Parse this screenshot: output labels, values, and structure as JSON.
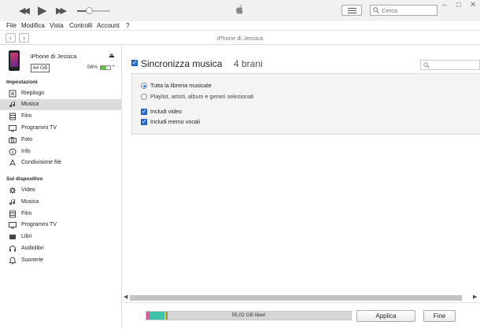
{
  "player": {
    "volume_percent": 35
  },
  "search": {
    "placeholder": "Cerca",
    "value": ""
  },
  "menu": [
    "File",
    "Modifica",
    "Vista",
    "Controlli",
    "Account",
    "?"
  ],
  "breadcrumb": "iPhone di Jessica",
  "device": {
    "name": "iPhone di Jessica",
    "capacity": "64 GB",
    "battery": "58%",
    "battery_fraction": 0.58
  },
  "sidebar": {
    "settings_header": "Impostazioni",
    "settings": [
      {
        "label": "Riepilogo",
        "icon": "summary-icon"
      },
      {
        "label": "Musica",
        "icon": "music-note-icon",
        "selected": true
      },
      {
        "label": "Film",
        "icon": "film-icon"
      },
      {
        "label": "Programmi TV",
        "icon": "tv-icon"
      },
      {
        "label": "Foto",
        "icon": "camera-icon"
      },
      {
        "label": "Info",
        "icon": "info-icon"
      },
      {
        "label": "Condivisione file",
        "icon": "file-sharing-icon"
      }
    ],
    "device_header": "Sul dispositivo",
    "on_device": [
      {
        "label": "Video",
        "icon": "video-gear-icon"
      },
      {
        "label": "Musica",
        "icon": "music-note-icon"
      },
      {
        "label": "Film",
        "icon": "film-icon"
      },
      {
        "label": "Programmi TV",
        "icon": "tv-icon"
      },
      {
        "label": "Libri",
        "icon": "book-icon"
      },
      {
        "label": "Audiolibri",
        "icon": "audiobook-icon"
      },
      {
        "label": "Suonerie",
        "icon": "bell-icon"
      }
    ]
  },
  "main": {
    "sync_label": "Sincronizza musica",
    "sync_count": "4 brani",
    "sync_checked": true,
    "options": {
      "radio_all": "Tutta la libreria musicale",
      "radio_selected": "Playlist, artisti, album e generi selezionati",
      "include_video": "Includi video",
      "include_voice_memos": "Includi memo vocali"
    }
  },
  "storage": {
    "free_label": "55,02 GB liberi",
    "segments": [
      {
        "color": "#e4569a",
        "fraction": 0.015
      },
      {
        "color": "#3cc4a8",
        "fraction": 0.075
      },
      {
        "color": "#f0c23a",
        "fraction": 0.008
      },
      {
        "color": "#8a8a8a",
        "fraction": 0.006
      }
    ]
  },
  "buttons": {
    "apply": "Applica",
    "done": "Fine"
  },
  "colors": {
    "accent": "#2b6fce",
    "selected_row": "#dcdcdc"
  }
}
